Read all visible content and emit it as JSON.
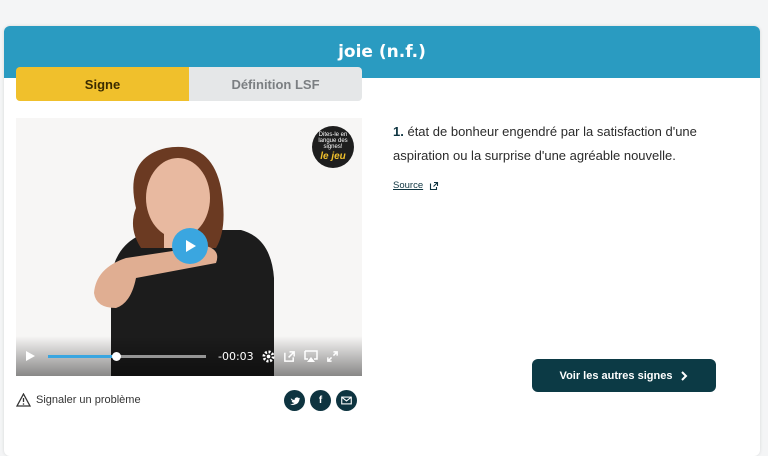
{
  "header": {
    "title": "joie (n.f.)"
  },
  "tabs": [
    {
      "label": "Signe",
      "active": true
    },
    {
      "label": "Définition LSF",
      "active": false
    }
  ],
  "video": {
    "logo_text": "Dites-le en langue des signes!",
    "logo_sub": "le jeu",
    "time_remaining": "-00:03",
    "progress": 0.43
  },
  "definition": {
    "number": "1.",
    "text": "état de bonheur engendré par la satisfaction d'une aspiration ou la surprise d'une agréable nouvelle."
  },
  "source": {
    "label": "Source"
  },
  "report": {
    "label": "Signaler un problème"
  },
  "share": {
    "facebook_glyph": "f"
  },
  "cta": {
    "label": "Voir les autres signes"
  },
  "colors": {
    "header": "#2a9bc1",
    "accent": "#f0c02c",
    "dark": "#0c3a45",
    "play": "#3aa6e0"
  }
}
